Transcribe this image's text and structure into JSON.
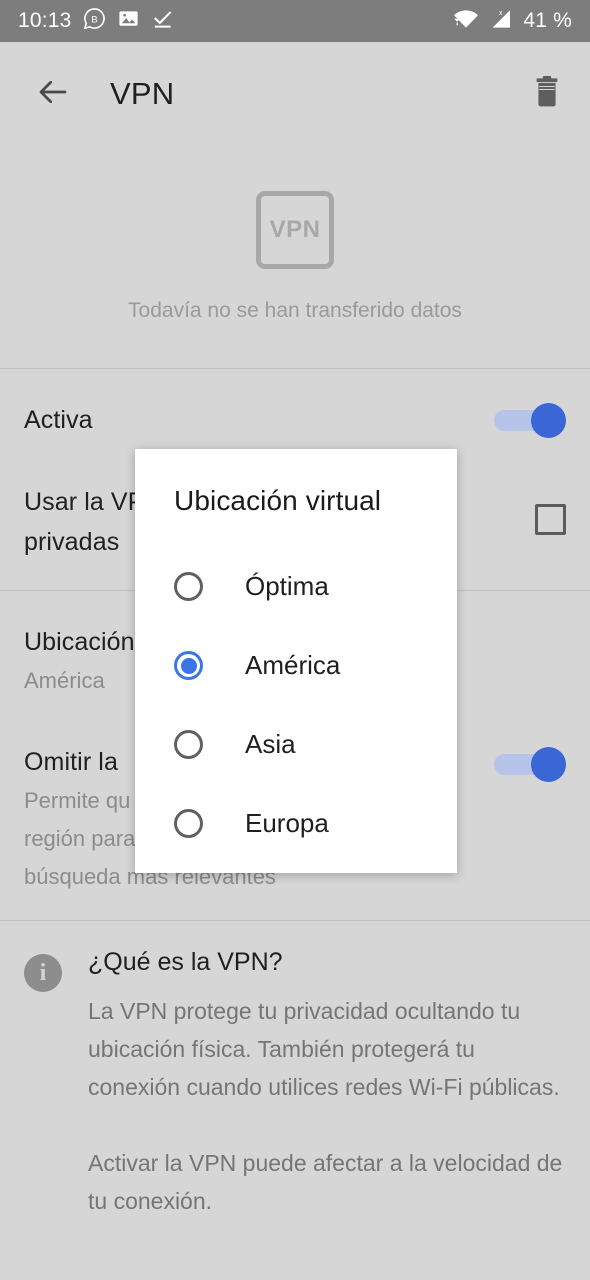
{
  "status_bar": {
    "time": "10:13",
    "battery": "41 %",
    "icons": [
      "chat-bubble-b-icon",
      "photo-icon",
      "check-download-icon",
      "wifi-icon",
      "cell-signal-icon"
    ],
    "background_color": "#7d7d7d"
  },
  "app_bar": {
    "title": "VPN",
    "back_icon": "arrow-left-icon",
    "delete_icon": "trash-icon"
  },
  "hero": {
    "badge_label": "VPN",
    "caption": "Todavía no se han transferido datos"
  },
  "settings": {
    "rows": [
      {
        "title": "Activa",
        "subtitle": "",
        "control": "switch",
        "checked": true
      },
      {
        "title": "Usar la VPN en las pestañas privadas",
        "title_visible": "Usar la VPN\nprivadas",
        "subtitle": "",
        "control": "checkbox",
        "checked": false
      },
      {
        "title": "Ubicación virtual",
        "title_visible": "Ubicación",
        "subtitle": "América",
        "control": "none",
        "checked": false
      },
      {
        "title": "Omitir la VPN",
        "title_visible": "Omitir la",
        "subtitle": "Permite que los sitios usen tu región para darte resultados de búsqueda más relevantes",
        "subtitle_lines": [
          "Permite qu",
          "región para",
          "búsqueda más relevantes"
        ],
        "control": "switch",
        "checked": true
      }
    ]
  },
  "info_section": {
    "icon": "info-circle-icon",
    "title": "¿Qué es la VPN?",
    "paragraph1": "La VPN protege tu privacidad ocultando tu ubicación física. También protegerá tu conexión cuando utilices redes Wi-Fi públicas.",
    "paragraph2": "Activar la VPN puede afectar a la velocidad de tu conexión."
  },
  "dialog": {
    "title": "Ubicación virtual",
    "selected": "América",
    "options": [
      {
        "label": "Óptima",
        "selected": false
      },
      {
        "label": "América",
        "selected": true
      },
      {
        "label": "Asia",
        "selected": false
      },
      {
        "label": "Europa",
        "selected": false
      }
    ]
  },
  "colors": {
    "accent": "#3b76e8",
    "switch_track": "#b6c4ea",
    "page_bg": "#d6d6d6",
    "statusbar_bg": "#7d7d7d",
    "dialog_bg": "#ffffff",
    "text_primary": "#202020",
    "text_secondary": "#8c8c8c"
  }
}
